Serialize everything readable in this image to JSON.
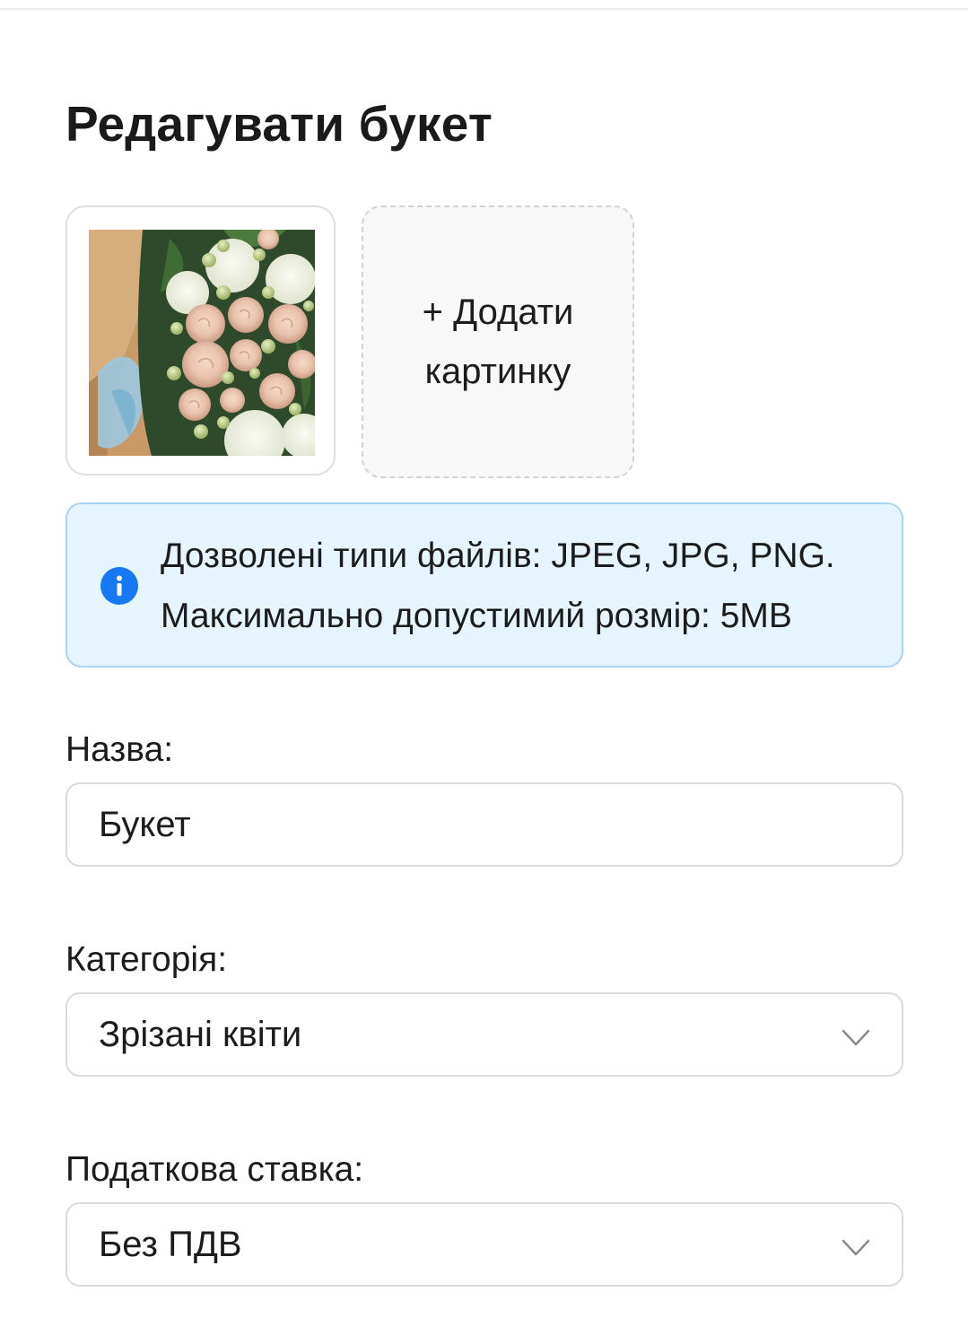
{
  "page": {
    "title": "Редагувати букет"
  },
  "images": {
    "add_label": "+ Додати картинку"
  },
  "info": {
    "icon": "info-icon",
    "line1": "Дозволені типи файлів: JPEG, JPG, PNG.",
    "line2": "Максимально допустимий розмір: 5MB",
    "colors": {
      "background": "#e6f4fe",
      "border": "#a9d3f2",
      "icon": "#1877f2"
    }
  },
  "form": {
    "name": {
      "label": "Назва:",
      "value": "Букет"
    },
    "category": {
      "label": "Категорія:",
      "value": "Зрізані квіти",
      "icon": "chevron-down-icon"
    },
    "tax_rate": {
      "label": "Податкова ставка:",
      "value": "Без ПДВ",
      "icon": "chevron-down-icon"
    }
  }
}
